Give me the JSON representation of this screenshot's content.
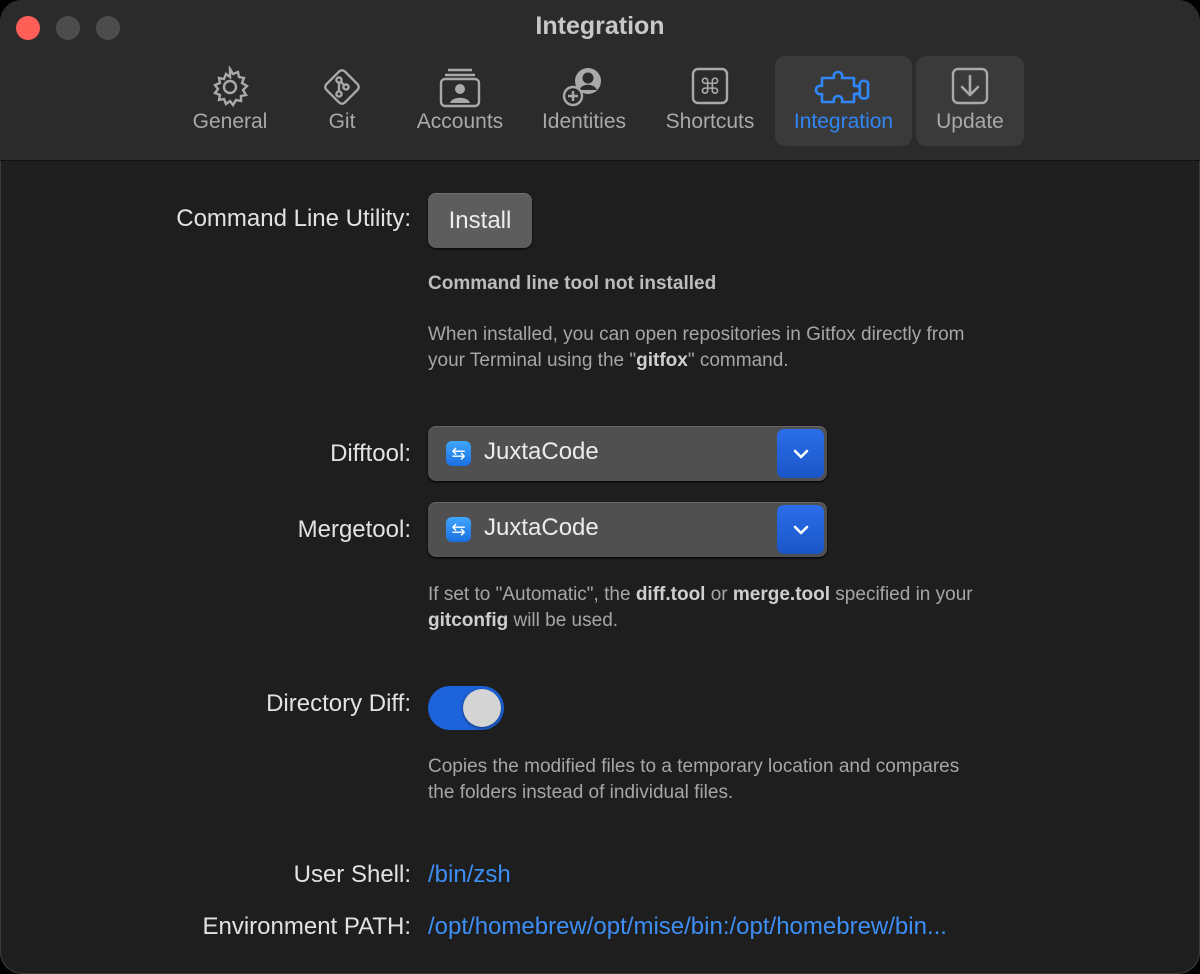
{
  "window": {
    "title": "Integration"
  },
  "tabs": [
    {
      "label": "General",
      "icon": "gear-icon"
    },
    {
      "label": "Git",
      "icon": "git-icon"
    },
    {
      "label": "Accounts",
      "icon": "accounts-icon"
    },
    {
      "label": "Identities",
      "icon": "identities-icon"
    },
    {
      "label": "Shortcuts",
      "icon": "command-key-icon"
    },
    {
      "label": "Integration",
      "icon": "puzzle-icon",
      "selected": true
    },
    {
      "label": "Update",
      "icon": "download-icon"
    }
  ],
  "cli": {
    "label": "Command Line Utility:",
    "button": "Install",
    "status": "Command line tool not installed",
    "desc_1": "When installed, you can open repositories in Gitfox directly from",
    "desc_2a": "your Terminal using the \"",
    "desc_2b": "gitfox",
    "desc_2c": "\" command."
  },
  "difftool": {
    "label": "Difftool:",
    "value": "JuxtaCode"
  },
  "mergetool": {
    "label": "Mergetool:",
    "value": "JuxtaCode"
  },
  "tools_note": {
    "p1": "If set to \"Automatic\", the ",
    "b1": "diff.tool",
    "p2": " or ",
    "b2": "merge.tool",
    "p3": " specified in your",
    "b3": "gitconfig",
    "p4": " will be used."
  },
  "directory_diff": {
    "label": "Directory Diff:",
    "enabled": true,
    "desc_1": "Copies the modified files to a temporary location and compares",
    "desc_2": "the folders instead of individual files."
  },
  "user_shell": {
    "label": "User Shell:",
    "value": "/bin/zsh"
  },
  "env_path": {
    "label": "Environment PATH:",
    "value": "/opt/homebrew/opt/mise/bin:/opt/homebrew/bin..."
  },
  "colors": {
    "accent": "#2f86f4",
    "link": "#3d8ef5",
    "close": "#fe5f57"
  }
}
